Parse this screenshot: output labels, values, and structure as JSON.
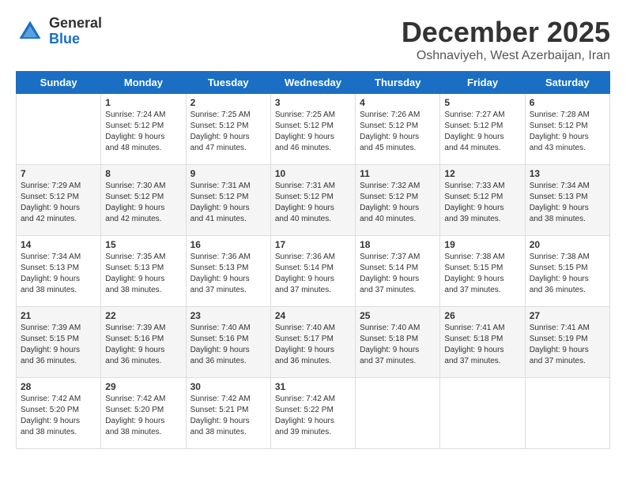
{
  "header": {
    "logo_general": "General",
    "logo_blue": "Blue",
    "month_year": "December 2025",
    "location": "Oshnaviyeh, West Azerbaijan, Iran"
  },
  "weekdays": [
    "Sunday",
    "Monday",
    "Tuesday",
    "Wednesday",
    "Thursday",
    "Friday",
    "Saturday"
  ],
  "weeks": [
    [
      {
        "day": "",
        "info": ""
      },
      {
        "day": "1",
        "info": "Sunrise: 7:24 AM\nSunset: 5:12 PM\nDaylight: 9 hours\nand 48 minutes."
      },
      {
        "day": "2",
        "info": "Sunrise: 7:25 AM\nSunset: 5:12 PM\nDaylight: 9 hours\nand 47 minutes."
      },
      {
        "day": "3",
        "info": "Sunrise: 7:25 AM\nSunset: 5:12 PM\nDaylight: 9 hours\nand 46 minutes."
      },
      {
        "day": "4",
        "info": "Sunrise: 7:26 AM\nSunset: 5:12 PM\nDaylight: 9 hours\nand 45 minutes."
      },
      {
        "day": "5",
        "info": "Sunrise: 7:27 AM\nSunset: 5:12 PM\nDaylight: 9 hours\nand 44 minutes."
      },
      {
        "day": "6",
        "info": "Sunrise: 7:28 AM\nSunset: 5:12 PM\nDaylight: 9 hours\nand 43 minutes."
      }
    ],
    [
      {
        "day": "7",
        "info": "Sunrise: 7:29 AM\nSunset: 5:12 PM\nDaylight: 9 hours\nand 42 minutes."
      },
      {
        "day": "8",
        "info": "Sunrise: 7:30 AM\nSunset: 5:12 PM\nDaylight: 9 hours\nand 42 minutes."
      },
      {
        "day": "9",
        "info": "Sunrise: 7:31 AM\nSunset: 5:12 PM\nDaylight: 9 hours\nand 41 minutes."
      },
      {
        "day": "10",
        "info": "Sunrise: 7:31 AM\nSunset: 5:12 PM\nDaylight: 9 hours\nand 40 minutes."
      },
      {
        "day": "11",
        "info": "Sunrise: 7:32 AM\nSunset: 5:12 PM\nDaylight: 9 hours\nand 40 minutes."
      },
      {
        "day": "12",
        "info": "Sunrise: 7:33 AM\nSunset: 5:12 PM\nDaylight: 9 hours\nand 39 minutes."
      },
      {
        "day": "13",
        "info": "Sunrise: 7:34 AM\nSunset: 5:13 PM\nDaylight: 9 hours\nand 38 minutes."
      }
    ],
    [
      {
        "day": "14",
        "info": "Sunrise: 7:34 AM\nSunset: 5:13 PM\nDaylight: 9 hours\nand 38 minutes."
      },
      {
        "day": "15",
        "info": "Sunrise: 7:35 AM\nSunset: 5:13 PM\nDaylight: 9 hours\nand 38 minutes."
      },
      {
        "day": "16",
        "info": "Sunrise: 7:36 AM\nSunset: 5:13 PM\nDaylight: 9 hours\nand 37 minutes."
      },
      {
        "day": "17",
        "info": "Sunrise: 7:36 AM\nSunset: 5:14 PM\nDaylight: 9 hours\nand 37 minutes."
      },
      {
        "day": "18",
        "info": "Sunrise: 7:37 AM\nSunset: 5:14 PM\nDaylight: 9 hours\nand 37 minutes."
      },
      {
        "day": "19",
        "info": "Sunrise: 7:38 AM\nSunset: 5:15 PM\nDaylight: 9 hours\nand 37 minutes."
      },
      {
        "day": "20",
        "info": "Sunrise: 7:38 AM\nSunset: 5:15 PM\nDaylight: 9 hours\nand 36 minutes."
      }
    ],
    [
      {
        "day": "21",
        "info": "Sunrise: 7:39 AM\nSunset: 5:15 PM\nDaylight: 9 hours\nand 36 minutes."
      },
      {
        "day": "22",
        "info": "Sunrise: 7:39 AM\nSunset: 5:16 PM\nDaylight: 9 hours\nand 36 minutes."
      },
      {
        "day": "23",
        "info": "Sunrise: 7:40 AM\nSunset: 5:16 PM\nDaylight: 9 hours\nand 36 minutes."
      },
      {
        "day": "24",
        "info": "Sunrise: 7:40 AM\nSunset: 5:17 PM\nDaylight: 9 hours\nand 36 minutes."
      },
      {
        "day": "25",
        "info": "Sunrise: 7:40 AM\nSunset: 5:18 PM\nDaylight: 9 hours\nand 37 minutes."
      },
      {
        "day": "26",
        "info": "Sunrise: 7:41 AM\nSunset: 5:18 PM\nDaylight: 9 hours\nand 37 minutes."
      },
      {
        "day": "27",
        "info": "Sunrise: 7:41 AM\nSunset: 5:19 PM\nDaylight: 9 hours\nand 37 minutes."
      }
    ],
    [
      {
        "day": "28",
        "info": "Sunrise: 7:42 AM\nSunset: 5:20 PM\nDaylight: 9 hours\nand 38 minutes."
      },
      {
        "day": "29",
        "info": "Sunrise: 7:42 AM\nSunset: 5:20 PM\nDaylight: 9 hours\nand 38 minutes."
      },
      {
        "day": "30",
        "info": "Sunrise: 7:42 AM\nSunset: 5:21 PM\nDaylight: 9 hours\nand 38 minutes."
      },
      {
        "day": "31",
        "info": "Sunrise: 7:42 AM\nSunset: 5:22 PM\nDaylight: 9 hours\nand 39 minutes."
      },
      {
        "day": "",
        "info": ""
      },
      {
        "day": "",
        "info": ""
      },
      {
        "day": "",
        "info": ""
      }
    ]
  ]
}
